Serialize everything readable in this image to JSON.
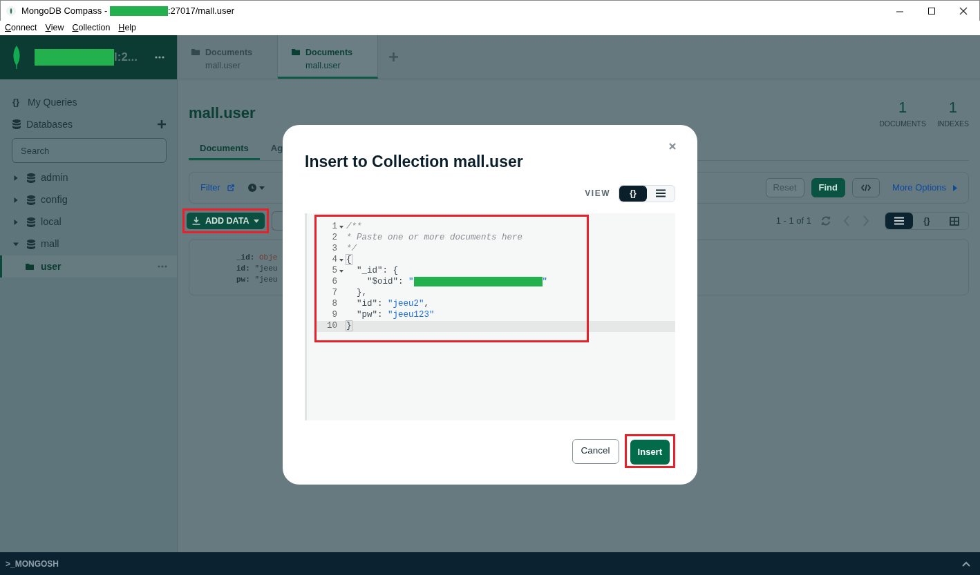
{
  "window": {
    "title_before_redaction": "MongoDB Compass - ",
    "title_after_redaction": ":27017/mall.user"
  },
  "menu": [
    "Connect",
    "View",
    "Collection",
    "Help"
  ],
  "connection": {
    "name_tail": "l:2..."
  },
  "tabs": [
    {
      "title": "Documents",
      "subtitle": "mall.user",
      "selected": false
    },
    {
      "title": "Documents",
      "subtitle": "mall.user",
      "selected": true
    }
  ],
  "sidebar": {
    "nav": [
      {
        "kind": "queries",
        "icon_text": "{}",
        "label": "My Queries"
      },
      {
        "kind": "databases",
        "label": "Databases"
      }
    ],
    "search": {
      "placeholder": "Search"
    },
    "databases": [
      {
        "name": "admin",
        "expanded": false
      },
      {
        "name": "config",
        "expanded": false
      },
      {
        "name": "local",
        "expanded": false
      },
      {
        "name": "mall",
        "expanded": true,
        "children": [
          {
            "name": "user",
            "selected": true
          }
        ]
      }
    ]
  },
  "collection": {
    "title": "mall.user",
    "stats": [
      {
        "value": "1",
        "label": "DOCUMENTS"
      },
      {
        "value": "1",
        "label": "INDEXES"
      }
    ],
    "tabs": [
      {
        "label": "Documents",
        "selected": true
      },
      {
        "label": "Ag",
        "selected": false
      }
    ],
    "filter_label": "Filter",
    "reset_label": "Reset",
    "find_label": "Find",
    "more_options_label": "More Options",
    "add_data": {
      "label": "ADD DATA",
      "highlighted": true
    },
    "pagination": "1 - 1 of 1",
    "view_modes": [
      {
        "kind": "list",
        "selected": true
      },
      {
        "kind": "json",
        "text": "{}",
        "selected": false
      },
      {
        "kind": "table",
        "selected": false
      }
    ],
    "document_fields": [
      {
        "key": "_id:",
        "value": "Obje",
        "kind": "objectid"
      },
      {
        "key": "id:",
        "value": "\"jeeu",
        "kind": "string"
      },
      {
        "key": "pw:",
        "value": "\"jeeu",
        "kind": "string"
      }
    ]
  },
  "modal": {
    "title": "Insert to Collection mall.user",
    "view_label": "VIEW",
    "view_modes": [
      {
        "kind": "json",
        "text": "{}",
        "selected": true
      },
      {
        "kind": "list",
        "selected": false
      }
    ],
    "editor": {
      "highlighted": true,
      "lines": [
        {
          "number": "1",
          "foldable": true,
          "active": false,
          "tokens": [
            {
              "text": "/**",
              "kind": "comment"
            }
          ]
        },
        {
          "number": "2",
          "foldable": false,
          "active": false,
          "tokens": [
            {
              "text": "* Paste one or more documents here",
              "kind": "comment"
            }
          ]
        },
        {
          "number": "3",
          "foldable": false,
          "active": false,
          "tokens": [
            {
              "text": "*/",
              "kind": "comment"
            }
          ]
        },
        {
          "number": "4",
          "foldable": true,
          "active": false,
          "tokens": [
            {
              "text": "{",
              "kind": "bracket"
            }
          ]
        },
        {
          "number": "5",
          "foldable": true,
          "active": false,
          "tokens": [
            {
              "text": "  \"_id\": {",
              "kind": "punct"
            }
          ]
        },
        {
          "number": "6",
          "foldable": false,
          "active": false,
          "tokens": [
            {
              "text": "    \"$oid\": ",
              "kind": "punct"
            },
            {
              "text": "\"",
              "kind": "string"
            },
            {
              "kind": "redaction"
            },
            {
              "text": "\"",
              "kind": "string"
            }
          ]
        },
        {
          "number": "7",
          "foldable": false,
          "active": false,
          "tokens": [
            {
              "text": "  },",
              "kind": "punct"
            }
          ]
        },
        {
          "number": "8",
          "foldable": false,
          "active": false,
          "tokens": [
            {
              "text": "  \"id\": ",
              "kind": "punct"
            },
            {
              "text": "\"jeeu2\"",
              "kind": "string"
            },
            {
              "text": ",",
              "kind": "punct"
            }
          ]
        },
        {
          "number": "9",
          "foldable": false,
          "active": false,
          "tokens": [
            {
              "text": "  \"pw\": ",
              "kind": "punct"
            },
            {
              "text": "\"jeeu123\"",
              "kind": "string"
            }
          ]
        },
        {
          "number": "10",
          "foldable": false,
          "active": true,
          "tokens": [
            {
              "text": "}",
              "kind": "bracket"
            }
          ]
        }
      ]
    },
    "cancel_label": "Cancel",
    "insert": {
      "label": "Insert",
      "highlighted": true
    }
  },
  "shell": {
    "label": ">_MONGOSH",
    "expanded": false
  }
}
